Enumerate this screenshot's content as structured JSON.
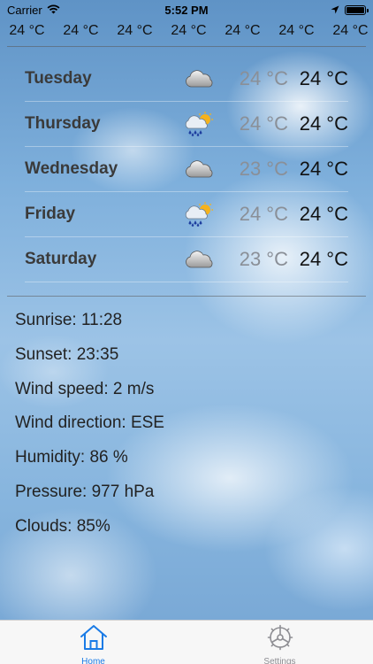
{
  "status_bar": {
    "carrier": "Carrier",
    "time": "5:52 PM"
  },
  "hourly": [
    "24 °C",
    "24 °C",
    "24 °C",
    "24 °C",
    "24 °C",
    "24 °C",
    "24 °C"
  ],
  "forecast": [
    {
      "day": "Tuesday",
      "icon": "cloud-icon",
      "min": "24 °C",
      "max": "24 °C"
    },
    {
      "day": "Thursday",
      "icon": "sun-cloud-rain-icon",
      "min": "24 °C",
      "max": "24 °C"
    },
    {
      "day": "Wednesday",
      "icon": "cloud-icon",
      "min": "23 °C",
      "max": "24 °C"
    },
    {
      "day": "Friday",
      "icon": "sun-cloud-rain-icon",
      "min": "24 °C",
      "max": "24 °C"
    },
    {
      "day": "Saturday",
      "icon": "cloud-icon",
      "min": "23 °C",
      "max": "24 °C"
    }
  ],
  "details": {
    "sunrise": "Sunrise: 11:28",
    "sunset": "Sunset: 23:35",
    "wind_speed": "Wind speed: 2 m/s",
    "wind_direction": "Wind direction: ESE",
    "humidity": "Humidity: 86 %",
    "pressure": "Pressure: 977 hPa",
    "clouds": "Clouds: 85%"
  },
  "tabs": [
    {
      "label": "Home",
      "icon": "home-icon",
      "active": true
    },
    {
      "label": "Settings",
      "icon": "gear-icon",
      "active": false
    }
  ],
  "colors": {
    "accent": "#1a7be6",
    "inactive": "#8e8e93"
  }
}
